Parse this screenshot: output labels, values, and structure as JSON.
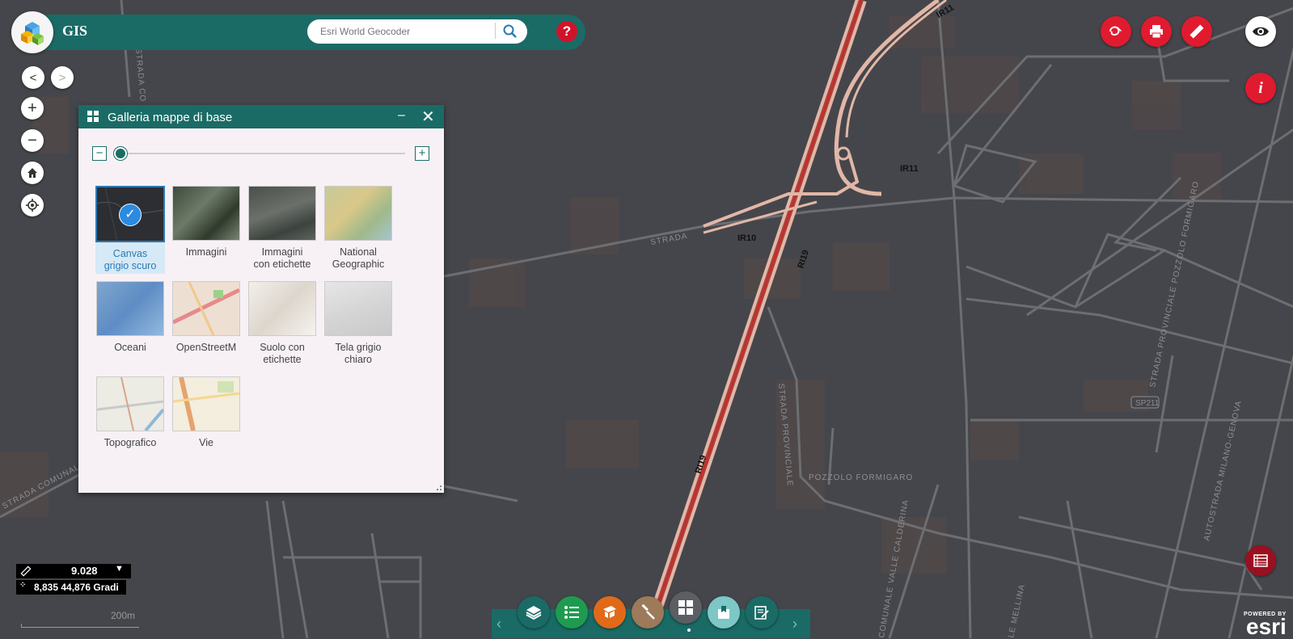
{
  "app": {
    "title": "GIS"
  },
  "search": {
    "placeholder": "Esri World Geocoder"
  },
  "header": {
    "help_label": "?"
  },
  "nav": {
    "back": "<",
    "forward": ">",
    "zoom_in": "+",
    "zoom_out": "−"
  },
  "panel": {
    "title": "Galleria mappe di base",
    "zoom_minus": "−",
    "zoom_plus": "+",
    "basemaps": [
      {
        "label_line1": "Canvas",
        "label_line2": "grigio scuro",
        "selected": true,
        "theme": "dark"
      },
      {
        "label_line1": "Immagini",
        "label_line2": "",
        "selected": false,
        "theme": "imagery"
      },
      {
        "label_line1": "Immagini",
        "label_line2": "con etichette",
        "selected": false,
        "theme": "imagery-labels"
      },
      {
        "label_line1": "National",
        "label_line2": "Geographic",
        "selected": false,
        "theme": "natgeo"
      },
      {
        "label_line1": "Oceani",
        "label_line2": "",
        "selected": false,
        "theme": "oceans"
      },
      {
        "label_line1": "OpenStreetM",
        "label_line2": "",
        "selected": false,
        "theme": "osm"
      },
      {
        "label_line1": "Suolo con",
        "label_line2": "etichette",
        "selected": false,
        "theme": "terrain"
      },
      {
        "label_line1": "Tela grigio",
        "label_line2": "chiaro",
        "selected": false,
        "theme": "light-gray"
      },
      {
        "label_line1": "Topografico",
        "label_line2": "",
        "selected": false,
        "theme": "topo"
      },
      {
        "label_line1": "Vie",
        "label_line2": "",
        "selected": false,
        "theme": "streets"
      }
    ]
  },
  "map_labels": {
    "ir11_top": "IR11",
    "ir11_mid": "IR11",
    "ir10": "IR10",
    "ri19_a": "RI19",
    "ri19_b": "RI19",
    "strada": "STRADA",
    "strada_co": "STRADA CO",
    "strada_provinciale": "STRADA PROVINCIALE",
    "pozzolo": "POZZOLO FORMIGARO",
    "comunale": "STRADA COMUNALE",
    "sp211": "SP211",
    "autostrada": "AUTOSTRADA MILANO-GENOVA",
    "sp_pozzolo": "STRADA PROVINCIALE POZZOLO FORMIGARO",
    "calderina": "COMUNALE VALLE CALDERINA",
    "mellina": "LE MELLINA"
  },
  "scale": {
    "value": "9.028",
    "coords": "8,835 44,876 Gradi",
    "bar_label": "200m"
  },
  "colors": {
    "accent": "#1a6b66",
    "alert": "#e01b2f",
    "selected": "#2a8be0",
    "map_bg": "#45464b"
  },
  "toolbar": {
    "icons": [
      "layers-icon",
      "legend-icon",
      "analysis-icon",
      "measure-icon",
      "basemap-gallery-icon",
      "bookmark-icon",
      "edit-icon"
    ],
    "colors": [
      "#1a6b66",
      "#1f9b4f",
      "#e06a19",
      "#9c7a5a",
      "#5b5e63",
      "#7dc7c7",
      "#1a6b66"
    ]
  },
  "attribution": {
    "powered_by": "POWERED BY",
    "brand": "esri"
  }
}
